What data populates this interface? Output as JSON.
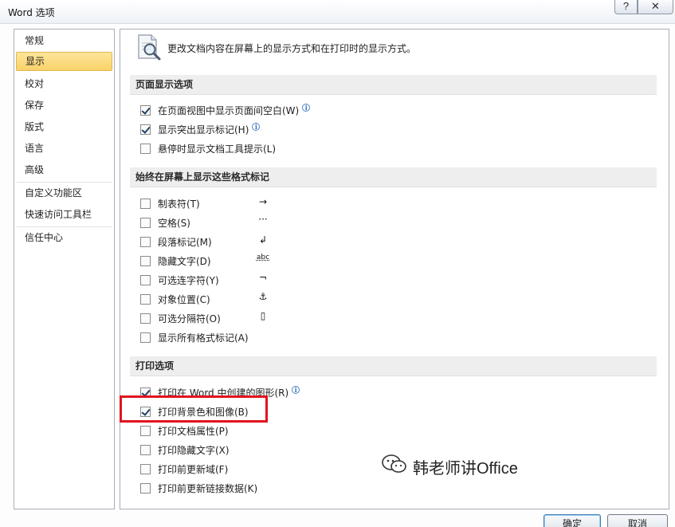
{
  "window": {
    "title": "Word 选项",
    "help_glyph": "?",
    "close_glyph": "✕"
  },
  "sidebar": {
    "items": [
      {
        "label": "常规"
      },
      {
        "label": "显示",
        "active": true
      },
      {
        "label": "校对"
      },
      {
        "label": "保存"
      },
      {
        "label": "版式"
      },
      {
        "label": "语言"
      },
      {
        "label": "高级"
      },
      {
        "label": "自定义功能区"
      },
      {
        "label": "快速访问工具栏"
      },
      {
        "label": "信任中心"
      }
    ]
  },
  "main": {
    "header_text": "更改文档内容在屏幕上的显示方式和在打印时的显示方式。",
    "page_display": {
      "title": "页面显示选项",
      "options": [
        {
          "label": "在页面视图中显示页面间空白(W)",
          "checked": true,
          "info": true
        },
        {
          "label": "显示突出显示标记(H)",
          "checked": true,
          "info": true
        },
        {
          "label": "悬停时显示文档工具提示(L)",
          "checked": false
        }
      ]
    },
    "format_marks": {
      "title": "始终在屏幕上显示这些格式标记",
      "options": [
        {
          "label": "制表符(T)",
          "checked": false,
          "glyph": "→"
        },
        {
          "label": "空格(S)",
          "checked": false,
          "glyph": "···"
        },
        {
          "label": "段落标记(M)",
          "checked": false,
          "glyph": "↲"
        },
        {
          "label": "隐藏文字(D)",
          "checked": false,
          "glyph": "abc"
        },
        {
          "label": "可选连字符(Y)",
          "checked": false,
          "glyph": "¬"
        },
        {
          "label": "对象位置(C)",
          "checked": false,
          "glyph": "⚓"
        },
        {
          "label": "可选分隔符(O)",
          "checked": false,
          "glyph": "▯"
        },
        {
          "label": "显示所有格式标记(A)",
          "checked": false
        }
      ]
    },
    "print": {
      "title": "打印选项",
      "options": [
        {
          "label": "打印在 Word 中创建的图形(R)",
          "checked": true,
          "info": true
        },
        {
          "label": "打印背景色和图像(B)",
          "checked": true
        },
        {
          "label": "打印文档属性(P)",
          "checked": false
        },
        {
          "label": "打印隐藏文字(X)",
          "checked": false
        },
        {
          "label": "打印前更新域(F)",
          "checked": false
        },
        {
          "label": "打印前更新链接数据(K)",
          "checked": false
        }
      ]
    },
    "info_glyph": "i"
  },
  "watermark": {
    "text": "韩老师讲Office"
  },
  "footer": {
    "ok_label": "确定",
    "cancel_label": "取消"
  },
  "colors": {
    "highlight_red": "#e0141e",
    "active_nav": "#f9d36a"
  }
}
